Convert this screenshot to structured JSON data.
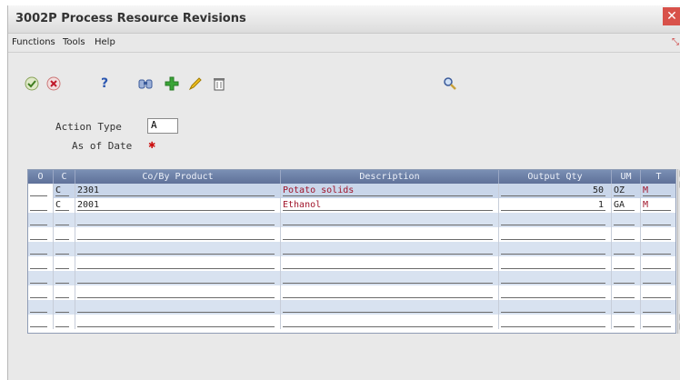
{
  "window": {
    "title": "3002P  Process Resource Revisions",
    "close_glyph": "✕"
  },
  "menu": {
    "functions": "Functions",
    "tools": "Tools",
    "help": "Help"
  },
  "toolbar": {
    "ok_icon": "checkmark-icon",
    "cancel_icon": "cancel-icon",
    "help_icon": "help-icon",
    "find_icon": "binoculars-icon",
    "add_icon": "add-icon",
    "edit_icon": "pencil-icon",
    "delete_icon": "trash-icon",
    "search_icon": "magnifier-icon"
  },
  "form": {
    "action_type_label": "Action Type",
    "action_type_value": "A",
    "as_of_date_label": "As of Date",
    "required_marker": "✱"
  },
  "grid": {
    "headers": [
      "O",
      "C",
      "Co/By Product",
      "Description",
      "Output Qty",
      "UM",
      "T"
    ],
    "rows": [
      {
        "o": "",
        "c": "C",
        "product": "2301",
        "description": "Potato solids",
        "qty": "50",
        "um": "OZ",
        "t": "M"
      },
      {
        "o": "",
        "c": "C",
        "product": "2001",
        "description": "Ethanol",
        "qty": "1",
        "um": "GA",
        "t": "M"
      }
    ]
  },
  "colors": {
    "header_bg": "#6a7ea6",
    "selected_row": "#c9d6ea",
    "alt_row": "#d8e2f0",
    "accent_red": "#a0152b"
  }
}
